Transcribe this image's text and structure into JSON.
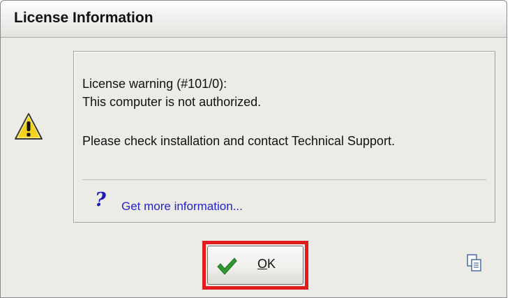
{
  "window": {
    "title": "License Information"
  },
  "message": {
    "line1": "License warning (#101/0):",
    "line2": "This computer is not authorized.",
    "line3": "Please check installation and contact Technical Support."
  },
  "help": {
    "link_text": "Get more information..."
  },
  "buttons": {
    "ok_mnemonic": "O",
    "ok_rest": "K"
  },
  "icons": {
    "warning": "warning-icon",
    "help": "question-icon",
    "ok": "checkmark-icon",
    "copy": "copy-icon"
  },
  "colors": {
    "highlight": "#e21c1c",
    "link": "#2323cc",
    "check": "#2f9a2f",
    "warning_fill": "#f4d21a"
  }
}
